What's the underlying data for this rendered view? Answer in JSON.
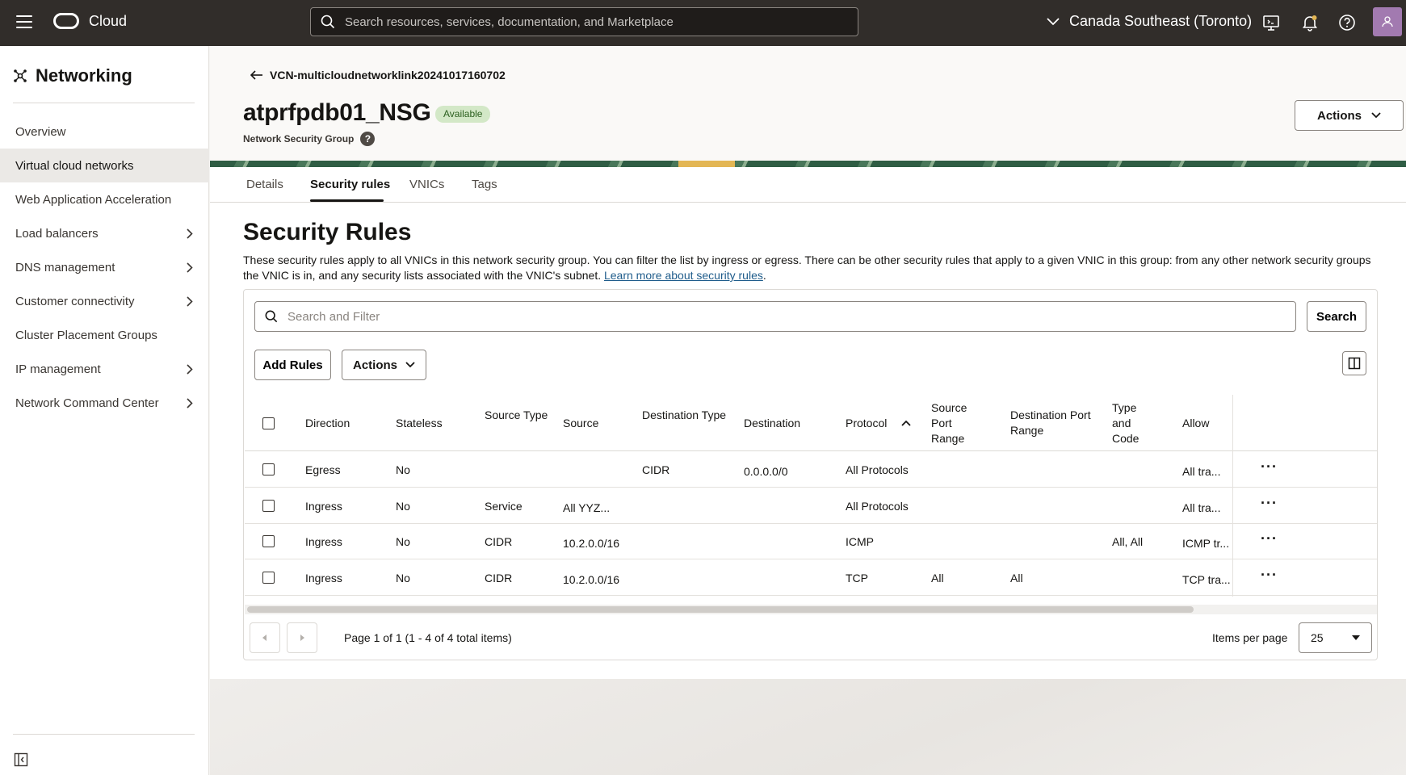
{
  "topbar": {
    "brand": "Cloud",
    "search_placeholder": "Search resources, services, documentation, and Marketplace",
    "region": "Canada Southeast (Toronto)"
  },
  "sidebar": {
    "title": "Networking",
    "items": [
      {
        "label": "Overview",
        "chevron": false,
        "active": false
      },
      {
        "label": "Virtual cloud networks",
        "chevron": false,
        "active": true
      },
      {
        "label": "Web Application Acceleration",
        "chevron": false,
        "active": false
      },
      {
        "label": "Load balancers",
        "chevron": true,
        "active": false
      },
      {
        "label": "DNS management",
        "chevron": true,
        "active": false
      },
      {
        "label": "Customer connectivity",
        "chevron": true,
        "active": false
      },
      {
        "label": "Cluster Placement Groups",
        "chevron": false,
        "active": false
      },
      {
        "label": "IP management",
        "chevron": true,
        "active": false
      },
      {
        "label": "Network Command Center",
        "chevron": true,
        "active": false
      }
    ]
  },
  "header": {
    "back_link": "VCN-multicloudnetworklink20241017160702",
    "title": "atprfpdb01_NSG",
    "status": "Available",
    "subtitle": "Network Security Group",
    "help": "?",
    "actions_label": "Actions"
  },
  "tabs": [
    "Details",
    "Security rules",
    "VNICs",
    "Tags"
  ],
  "section": {
    "title": "Security Rules",
    "description": "These security rules apply to all VNICs in this network security group. You can filter the list by ingress or egress. There can be other security rules that apply to a given VNIC in this group: from any other network security groups the VNIC is in, and any security lists associated with the VNIC's subnet. ",
    "link_text": "Learn more about security rules",
    "link_suffix": ".",
    "filter_placeholder": "Search and Filter",
    "search_label": "Search",
    "add_rules_label": "Add Rules",
    "actions_label": "Actions"
  },
  "table": {
    "columns": [
      "Direction",
      "Stateless",
      "Source Type",
      "Source",
      "Destination Type",
      "Destination",
      "Protocol",
      "Source Port Range",
      "Destination Port Range",
      "Type and Code",
      "Allow"
    ],
    "rows": [
      [
        "Egress",
        "No",
        "",
        "",
        "CIDR",
        "0.0.0.0/0",
        "All Protocols",
        "",
        "",
        "",
        "All tra..."
      ],
      [
        "Ingress",
        "No",
        "Service",
        "All YYZ...",
        "",
        "",
        "All Protocols",
        "",
        "",
        "",
        "All tra..."
      ],
      [
        "Ingress",
        "No",
        "CIDR",
        "10.2.0.0/16",
        "",
        "",
        "ICMP",
        "",
        "",
        "All, All",
        "ICMP tr..."
      ],
      [
        "Ingress",
        "No",
        "CIDR",
        "10.2.0.0/16",
        "",
        "",
        "TCP",
        "All",
        "All",
        "",
        "TCP tra..."
      ]
    ],
    "kebab": "···"
  },
  "pagination": {
    "text": "Page 1 of 1 (1 - 4 of 4 total items)",
    "items_per_page_label": "Items per page",
    "items_per_page": "25"
  }
}
